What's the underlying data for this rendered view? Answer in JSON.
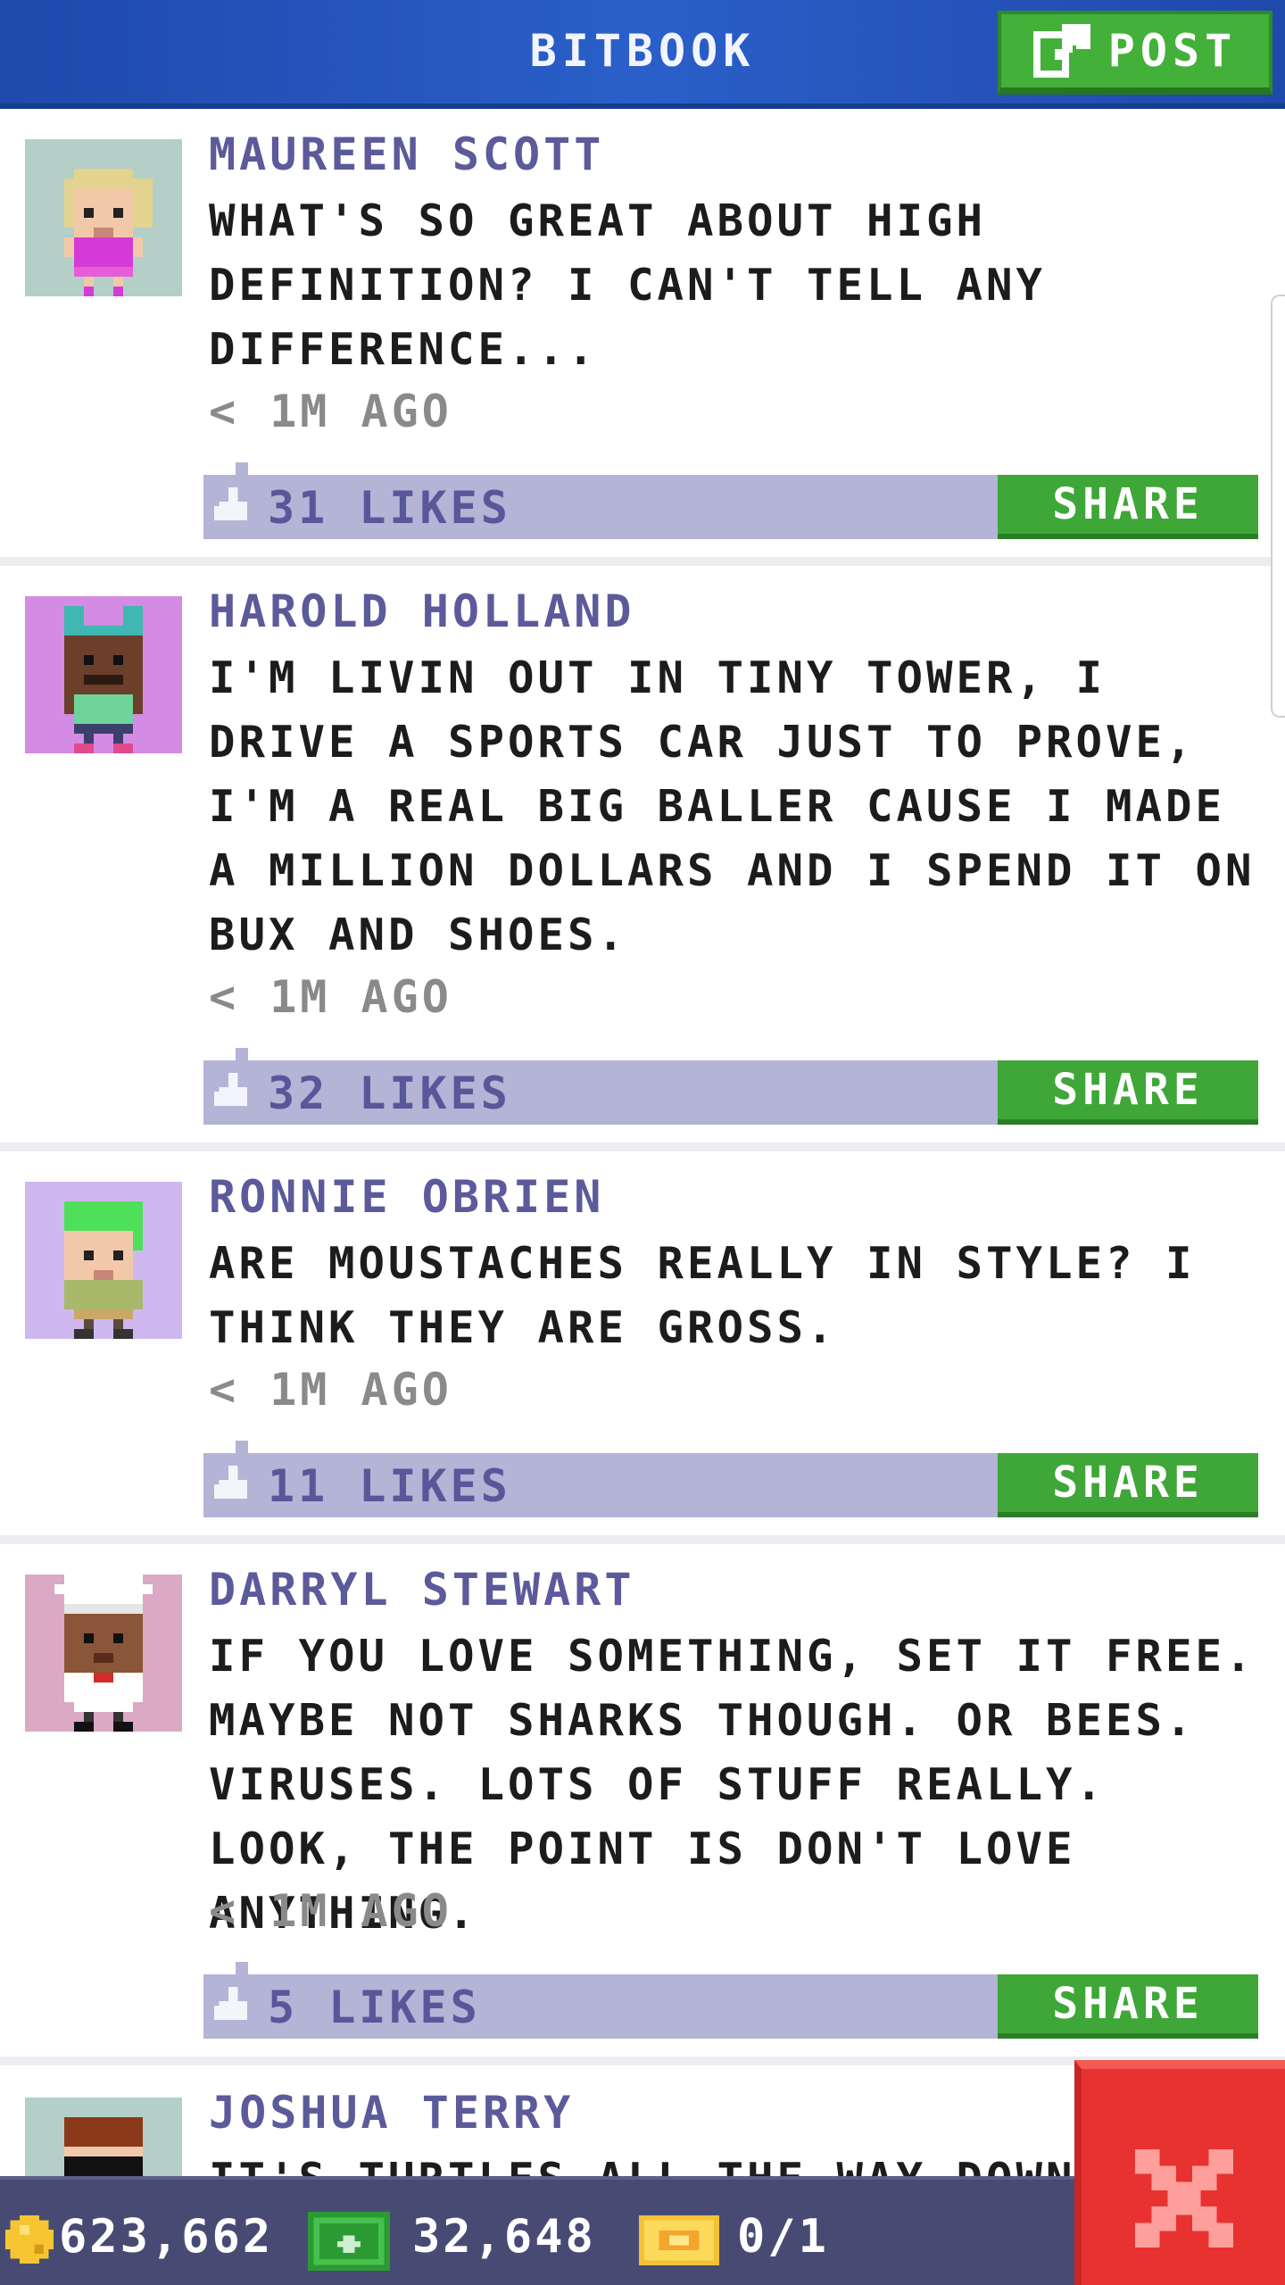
{
  "header": {
    "title": "BITBOOK",
    "post_label": "POST"
  },
  "posts": [
    {
      "author": "MAUREEN SCOTT",
      "text": "WHAT'S SO GREAT ABOUT HIGH DEFINITION? I CAN'T TELL ANY DIFFERENCE...",
      "time": "< 1M AGO",
      "likes": "31 LIKES",
      "share_label": "SHARE",
      "avatar_bg": "#b3cfc7"
    },
    {
      "author": "HAROLD HOLLAND",
      "text": "I'M LIVIN OUT IN TINY TOWER, I DRIVE A SPORTS CAR JUST TO PROVE, I'M A REAL BIG BALLER CAUSE I MADE A MILLION DOLLARS AND I SPEND IT ON BUX AND SHOES.",
      "time": "< 1M AGO",
      "likes": "32 LIKES",
      "share_label": "SHARE",
      "avatar_bg": "#d48be3"
    },
    {
      "author": "RONNIE OBRIEN",
      "text": "ARE MOUSTACHES REALLY IN STYLE? I THINK THEY ARE GROSS.",
      "time": "< 1M AGO",
      "likes": "11 LIKES",
      "share_label": "SHARE",
      "avatar_bg": "#cfb8ef"
    },
    {
      "author": "DARRYL STEWART",
      "text": "IF YOU LOVE SOMETHING, SET IT FREE. MAYBE NOT SHARKS THOUGH. OR BEES. VIRUSES. LOTS OF STUFF REALLY. LOOK, THE POINT IS DON'T LOVE ANYTHING.",
      "time": "< 1M AGO",
      "likes": "5 LIKES",
      "share_label": "SHARE",
      "avatar_bg": "#dba9c4"
    },
    {
      "author": "JOSHUA TERRY",
      "text": "IT'S TURTLES ALL THE WAY DOWN",
      "avatar_bg": "#b3cfc7"
    }
  ],
  "status_bar": {
    "coins": "623,662",
    "bux": "32,648",
    "tickets": "0/1"
  },
  "colors": {
    "header_blue": "#2a5fc9",
    "accent_green": "#43b03a",
    "likes_bar": "#b3b4d6",
    "author_purple": "#5b5a9a",
    "close_red": "#e8322f",
    "status_bar": "#474b74"
  },
  "icons": {
    "post": "edit-icon",
    "like": "thumbs-up-icon",
    "coin": "coin-icon",
    "bux": "bux-icon",
    "ticket": "ticket-icon",
    "close": "close-icon"
  }
}
